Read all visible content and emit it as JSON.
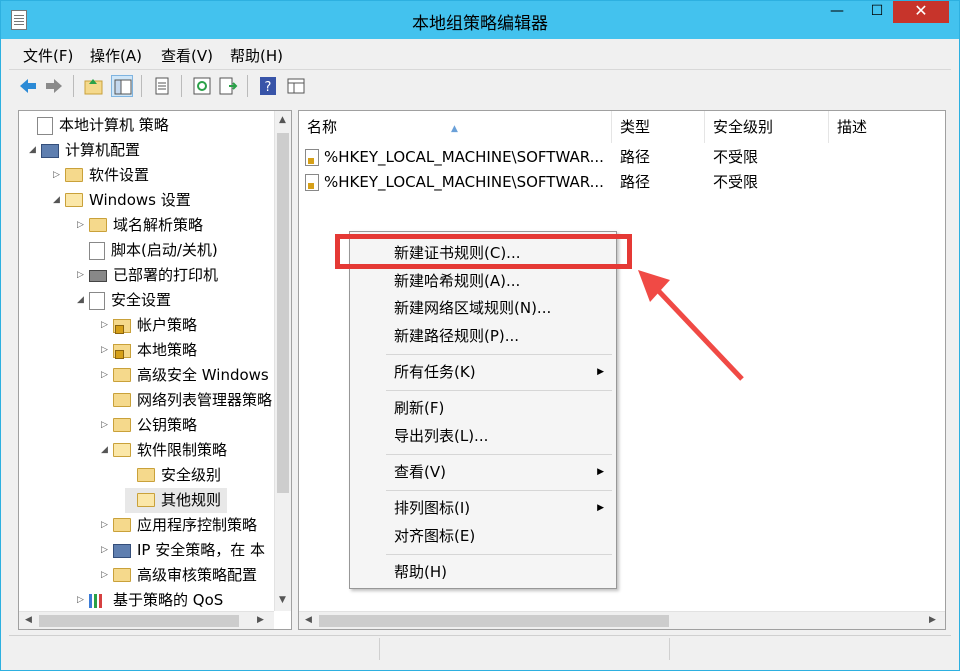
{
  "window": {
    "title": "本地组策略编辑器",
    "minimize": "—",
    "maximize": "☐",
    "close": "✕"
  },
  "menubar": {
    "items": [
      "文件(F)",
      "操作(A)",
      "查看(V)",
      "帮助(H)"
    ]
  },
  "tree": {
    "items": [
      {
        "label": "本地计算机 策略",
        "icon": "policy-doc-icon",
        "expander": ""
      },
      {
        "label": "计算机配置",
        "icon": "computer-icon",
        "expander": "◢"
      },
      {
        "label": "软件设置",
        "icon": "folder-icon",
        "expander": "▷"
      },
      {
        "label": "Windows 设置",
        "icon": "folder-icon",
        "expander": "◢"
      },
      {
        "label": "域名解析策略",
        "icon": "folder-icon",
        "expander": "▷"
      },
      {
        "label": "脚本(启动/关机)",
        "icon": "script-icon",
        "expander": ""
      },
      {
        "label": "已部署的打印机",
        "icon": "printer-icon",
        "expander": "▷"
      },
      {
        "label": "安全设置",
        "icon": "security-icon",
        "expander": "◢"
      },
      {
        "label": "帐户策略",
        "icon": "locked-folder-icon",
        "expander": "▷"
      },
      {
        "label": "本地策略",
        "icon": "locked-folder-icon",
        "expander": "▷"
      },
      {
        "label": "高级安全 Windows",
        "icon": "folder-icon",
        "expander": "▷"
      },
      {
        "label": "网络列表管理器策略",
        "icon": "folder-icon",
        "expander": ""
      },
      {
        "label": "公钥策略",
        "icon": "folder-icon",
        "expander": "▷"
      },
      {
        "label": "软件限制策略",
        "icon": "folder-icon",
        "expander": "◢"
      },
      {
        "label": "安全级别",
        "icon": "folder-icon",
        "expander": ""
      },
      {
        "label": "其他规则",
        "icon": "folder-icon",
        "expander": ""
      },
      {
        "label": "应用程序控制策略",
        "icon": "folder-icon",
        "expander": "▷"
      },
      {
        "label": "IP 安全策略，在 本",
        "icon": "ip-security-icon",
        "expander": "▷"
      },
      {
        "label": "高级审核策略配置",
        "icon": "folder-icon",
        "expander": "▷"
      },
      {
        "label": "基于策略的 QoS",
        "icon": "chart-icon",
        "expander": "▷"
      }
    ]
  },
  "list": {
    "columns": [
      "名称",
      "类型",
      "安全级别",
      "描述"
    ],
    "rows": [
      {
        "name": "%HKEY_LOCAL_MACHINE\\SOFTWAR...",
        "type": "路径",
        "level": "不受限",
        "desc": ""
      },
      {
        "name": "%HKEY_LOCAL_MACHINE\\SOFTWAR...",
        "type": "路径",
        "level": "不受限",
        "desc": ""
      }
    ]
  },
  "context_menu": {
    "items": [
      {
        "label": "新建证书规则(C)...",
        "submenu": false
      },
      {
        "label": "新建哈希规则(A)...",
        "submenu": false
      },
      {
        "label": "新建网络区域规则(N)...",
        "submenu": false
      },
      {
        "label": "新建路径规则(P)...",
        "submenu": false
      },
      {
        "label": "所有任务(K)",
        "submenu": true
      },
      {
        "label": "刷新(F)",
        "submenu": false
      },
      {
        "label": "导出列表(L)...",
        "submenu": false
      },
      {
        "label": "查看(V)",
        "submenu": true
      },
      {
        "label": "排列图标(I)",
        "submenu": true
      },
      {
        "label": "对齐图标(E)",
        "submenu": false
      },
      {
        "label": "帮助(H)",
        "submenu": false
      }
    ],
    "submenu_glyph": "▶"
  },
  "annotation": {
    "highlight_color": "#e53935",
    "arrow_color": "#f04a45"
  },
  "colors": {
    "titlebar": "#43c2ee",
    "close_button": "#c7342b"
  }
}
